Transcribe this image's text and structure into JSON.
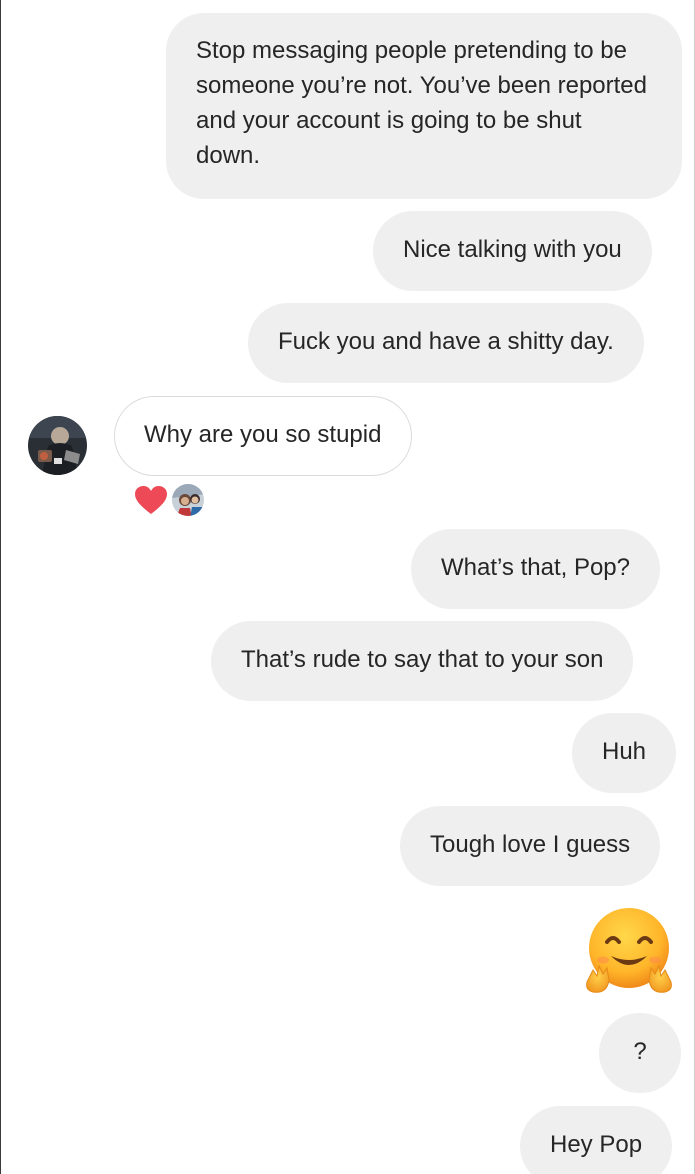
{
  "conversation": {
    "messages": [
      {
        "direction": "outgoing",
        "text": "Stop messaging people pretending to be someone you’re not. You’ve been reported and your account is going to be shut down."
      },
      {
        "direction": "outgoing",
        "text": "Nice talking with you"
      },
      {
        "direction": "outgoing",
        "text": "Fuck you and have a shitty day."
      },
      {
        "direction": "incoming",
        "text": "Why are you so stupid"
      },
      {
        "direction": "outgoing",
        "text": "What’s that, Pop?"
      },
      {
        "direction": "outgoing",
        "text": "That’s rude to say that to your son"
      },
      {
        "direction": "outgoing",
        "text": "Huh"
      },
      {
        "direction": "outgoing",
        "text": "Tough love I guess"
      },
      {
        "direction": "outgoing",
        "emoji": "hugging-face-emoji"
      },
      {
        "direction": "outgoing",
        "text": "?"
      },
      {
        "direction": "outgoing",
        "text": "Hey Pop"
      }
    ],
    "reactions": [
      {
        "icon": "heart-icon",
        "color": "#ed4956"
      },
      {
        "icon": "reactor-avatar"
      }
    ]
  },
  "colors": {
    "outgoing_bubble": "#efefef",
    "incoming_border": "#dbdbdb",
    "text": "#262626",
    "heart": "#ed4956"
  }
}
